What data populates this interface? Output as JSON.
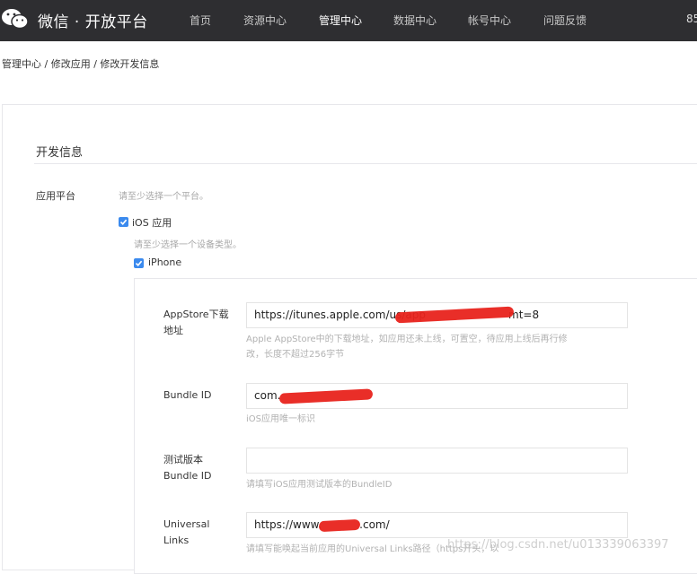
{
  "header": {
    "logo_icon": "wechat-icon",
    "title": "微信 · 开放平台",
    "nav": [
      "首页",
      "资源中心",
      "管理中心",
      "数据中心",
      "帐号中心",
      "问题反馈"
    ],
    "active_nav": "管理中心",
    "extra": "85"
  },
  "breadcrumb": "管理中心 / 修改应用 / 修改开发信息",
  "section": {
    "title": "开发信息",
    "platform_label": "应用平台",
    "platform_hint": "请至少选择一个平台。",
    "ios_label": "iOS 应用",
    "ios_checked": true,
    "device_hint": "请至少选择一个设备类型。",
    "iphone_label": "iPhone",
    "iphone_checked": true
  },
  "fields": {
    "appstore": {
      "label_line1": "AppStore下载",
      "label_line2": "地址",
      "value_prefix": "https://itunes.apple.com/us/app",
      "value_suffix": "mt=8",
      "hint_line1": "Apple AppStore中的下载地址，如应用还未上线，可置空，待应用上线后再行修",
      "hint_line2": "改，长度不超过256字节"
    },
    "bundle_id": {
      "label": "Bundle ID",
      "value_prefix": "com.",
      "hint": "iOS应用唯一标识"
    },
    "test_bundle": {
      "label_line1": "测试版本",
      "label_line2": "Bundle ID",
      "value": "",
      "hint": "请填写iOS应用测试版本的BundleID"
    },
    "universal_links": {
      "label_line1": "Universal",
      "label_line2": "Links",
      "value_prefix": "https://www.",
      "value_suffix": ".com/",
      "hint": "请填写能唤起当前应用的Universal Links路径（https开头，以"
    }
  },
  "watermark": "https://blog.csdn.net/u013339063397",
  "colors": {
    "topbar": "#2e2e31",
    "checkbox": "#3b8aee",
    "redaction": "#e8231c"
  }
}
